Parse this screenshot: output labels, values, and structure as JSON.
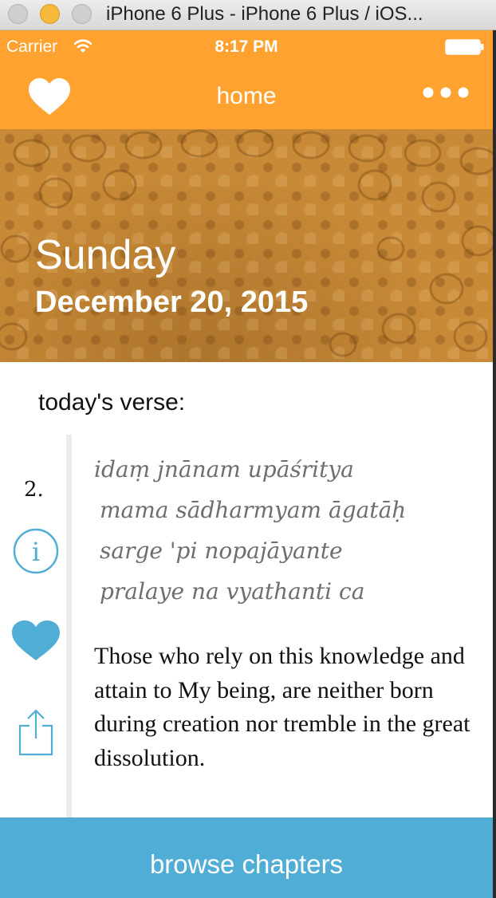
{
  "window": {
    "title": "iPhone 6 Plus - iPhone 6 Plus / iOS..."
  },
  "status_bar": {
    "carrier": "Carrier",
    "time": "8:17 PM"
  },
  "nav": {
    "title": "home"
  },
  "hero": {
    "day": "Sunday",
    "date": "December 20, 2015"
  },
  "verse": {
    "heading": "today's verse:",
    "number": "2.",
    "sanskrit_lines": [
      "idaṃ jnānam upāśritya",
      "mama sādharmyam āgatāḥ",
      "sarge 'pi nopajāyante",
      "pralaye na vyathanti ca"
    ],
    "translation": "Those who rely on this knowledge and attain to My being, are neither born during creation nor tremble in the great dissolution."
  },
  "footer": {
    "browse_label": "browse chapters"
  },
  "colors": {
    "accent_orange": "#ffa22f",
    "accent_blue": "#4fadd6"
  },
  "icons": [
    "wifi-icon",
    "battery-icon",
    "heart-icon",
    "more-icon",
    "info-icon",
    "share-icon"
  ]
}
